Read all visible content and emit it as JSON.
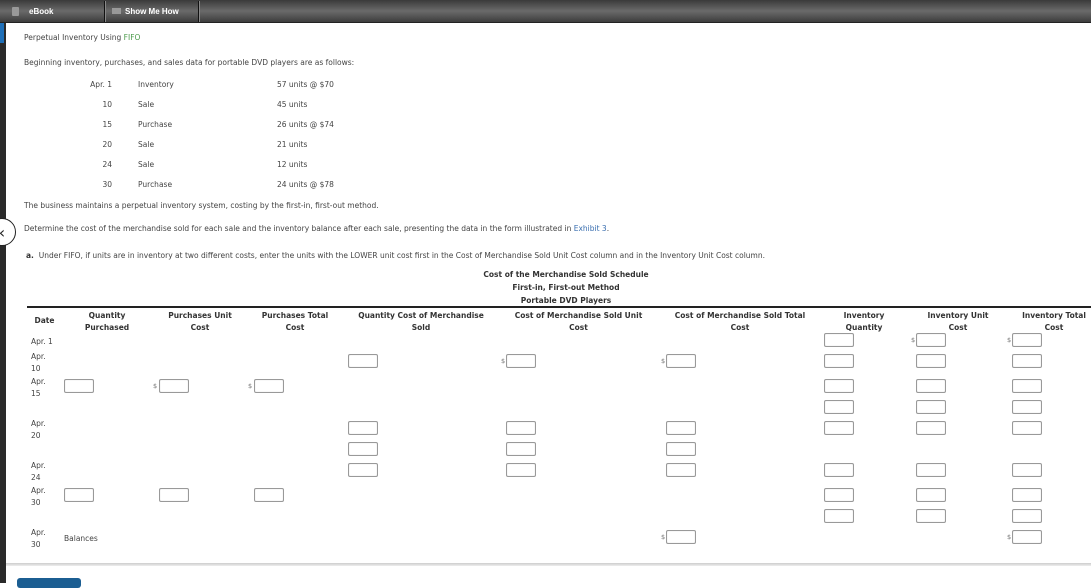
{
  "topbar": {
    "tabs": [
      {
        "label": "eBook",
        "icon": "book-icon"
      },
      {
        "label": "Show Me How",
        "icon": "video-camera-icon"
      }
    ]
  },
  "problem": {
    "title_prefix": "Perpetual Inventory Using ",
    "title_link": "FIFO",
    "intro": "Beginning inventory, purchases, and sales data for portable DVD players are as follows:",
    "transactions": [
      {
        "date": "Apr. 1",
        "type": "Inventory",
        "detail": "57 units @ $70"
      },
      {
        "date": "10",
        "type": "Sale",
        "detail": "45 units"
      },
      {
        "date": "15",
        "type": "Purchase",
        "detail": "26 units @ $74"
      },
      {
        "date": "20",
        "type": "Sale",
        "detail": "21 units"
      },
      {
        "date": "24",
        "type": "Sale",
        "detail": "12 units"
      },
      {
        "date": "30",
        "type": "Purchase",
        "detail": "24 units @ $78"
      }
    ],
    "method_text": "The business maintains a perpetual inventory system, costing by the first-in, first-out method.",
    "instruction_prefix": "Determine the cost of the merchandise sold for each sale and the inventory balance after each sale, presenting the data in the form illustrated in ",
    "instruction_link": "Exhibit 3",
    "instruction_suffix": ".",
    "part_a_label": "a.",
    "part_a_text": "Under FIFO, if units are in inventory at two different costs, enter the units with the LOWER unit cost first in the Cost of Merchandise Sold Unit Cost column and in the Inventory Unit Cost column."
  },
  "schedule": {
    "title": "Cost of the Merchandise Sold Schedule",
    "subtitle": "First-in, First-out Method",
    "product": "Portable DVD Players",
    "columns": [
      "Date",
      "Quantity Purchased",
      "Purchases Unit Cost",
      "Purchases Total Cost",
      "Quantity Cost of Merchandise Sold",
      "Cost of Merchandise Sold Unit Cost",
      "Cost of Merchandise Sold Total Cost",
      "Inventory Quantity",
      "Inventory Unit Cost",
      "Inventory Total Cost"
    ],
    "rows": [
      {
        "date_line1": "Apr. 1",
        "date_line2": ""
      },
      {
        "date_line1": "Apr.",
        "date_line2": "10"
      },
      {
        "date_line1": "Apr.",
        "date_line2": "15"
      },
      {
        "date_line1": "Apr.",
        "date_line2": "20"
      },
      {
        "date_line1": "Apr.",
        "date_line2": "24"
      },
      {
        "date_line1": "Apr.",
        "date_line2": "30"
      },
      {
        "date_line1": "Apr.",
        "date_line2": "30",
        "label": "Balances"
      }
    ],
    "currency_symbol": "$"
  }
}
